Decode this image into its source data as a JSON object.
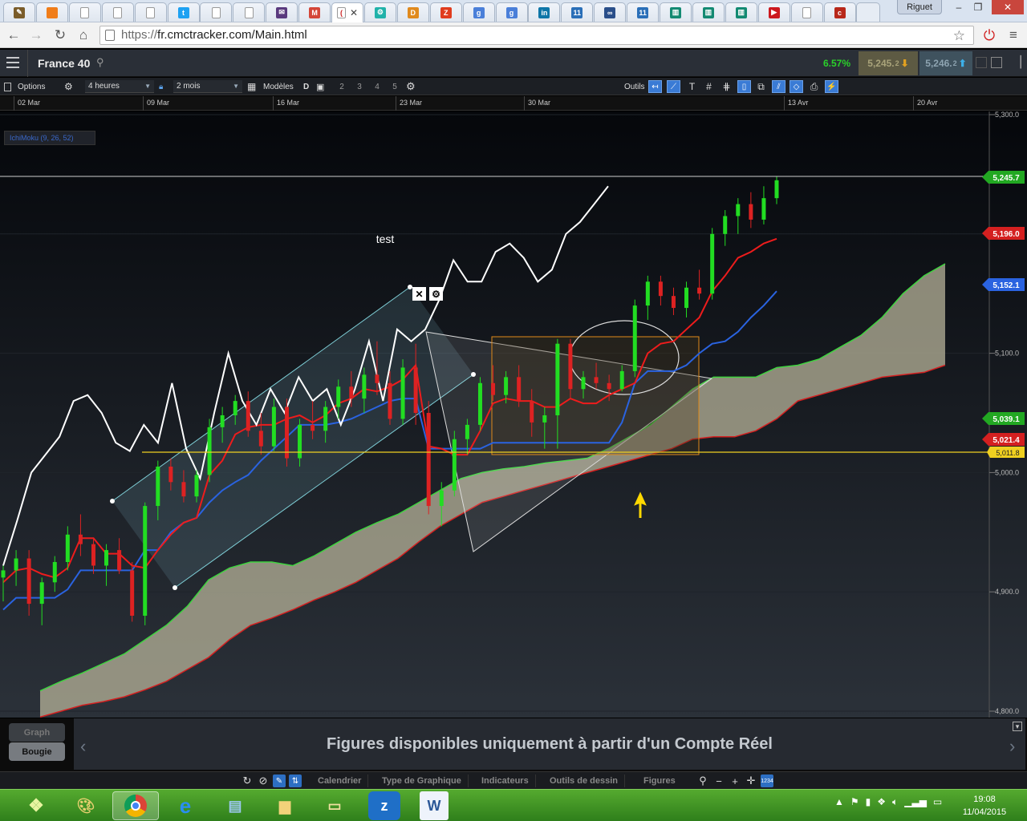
{
  "browser": {
    "tabs": [
      {
        "icon": "pen-icon",
        "color": "#7a5c2a",
        "glyph": "✎"
      },
      {
        "icon": "orange-square-icon",
        "color": "#f07d1a",
        "glyph": ""
      },
      {
        "icon": "page-icon",
        "color": "#ffffff",
        "glyph": ""
      },
      {
        "icon": "page-icon",
        "color": "#ffffff",
        "glyph": ""
      },
      {
        "icon": "page-icon",
        "color": "#ffffff",
        "glyph": ""
      },
      {
        "icon": "twitter-icon",
        "color": "#1da1f2",
        "glyph": "t"
      },
      {
        "icon": "page-icon",
        "color": "#ffffff",
        "glyph": ""
      },
      {
        "icon": "page-icon",
        "color": "#ffffff",
        "glyph": ""
      },
      {
        "icon": "mail-icon",
        "color": "#5a3a7e",
        "glyph": "✉"
      },
      {
        "icon": "gmail-icon",
        "color": "#d44638",
        "glyph": "M"
      },
      {
        "icon": "cmc-icon",
        "color": "#ffffff",
        "glyph": "(",
        "active": true
      },
      {
        "icon": "settings-wheel-icon",
        "color": "#20b2aa",
        "glyph": "⚙"
      },
      {
        "icon": "dfx-icon",
        "color": "#e08a1e",
        "glyph": "D"
      },
      {
        "icon": "zonebourse-icon",
        "color": "#e03c1e",
        "glyph": "Z"
      },
      {
        "icon": "google-icon",
        "color": "#4a7fd9",
        "glyph": "g"
      },
      {
        "icon": "google-icon",
        "color": "#4a7fd9",
        "glyph": "g"
      },
      {
        "icon": "linkedin-icon",
        "color": "#0e76a8",
        "glyph": "in"
      },
      {
        "icon": "calendar-icon",
        "color": "#2a6fb8",
        "glyph": "11"
      },
      {
        "icon": "link-icon",
        "color": "#2a4f8a",
        "glyph": "∞"
      },
      {
        "icon": "calendar-icon",
        "color": "#2a6fb8",
        "glyph": "11"
      },
      {
        "icon": "bars-icon",
        "color": "#138a72",
        "glyph": "▥"
      },
      {
        "icon": "bars-icon",
        "color": "#138a72",
        "glyph": "▥"
      },
      {
        "icon": "bars-icon",
        "color": "#138a72",
        "glyph": "▥"
      },
      {
        "icon": "youtube-icon",
        "color": "#cc181e",
        "glyph": "▶"
      },
      {
        "icon": "page-icon",
        "color": "#ffffff",
        "glyph": ""
      },
      {
        "icon": "red-circle-icon",
        "color": "#b8281a",
        "glyph": "c"
      },
      {
        "icon": "new-tab-icon",
        "color": "#e6ecf4",
        "glyph": ""
      }
    ],
    "profile_name": "Riguet",
    "url_scheme": "https://",
    "url_rest": "fr.cmctracker.com/Main.html"
  },
  "app": {
    "instrument": "France 40",
    "change_pct": "6.57%",
    "sell_price_main": "5,245.",
    "sell_price_small": "2",
    "buy_price_main": "5,246.",
    "buy_price_small": "2"
  },
  "toolbar": {
    "options_label": "Options",
    "timeframe": "4 heures",
    "range": "2 mois",
    "templates_label": "Modèles",
    "d_label": "D",
    "pages": [
      "2",
      "3",
      "4",
      "5"
    ],
    "tools_label": "Outils"
  },
  "dates": [
    "02 Mar",
    "09 Mar",
    "16 Mar",
    "23 Mar",
    "30 Mar",
    "13 Avr",
    "20 Avr"
  ],
  "indicator_legend": "IchiMoku (9, 26, 52)",
  "annotation_text": "test",
  "price_labels": {
    "last": "5,245.7",
    "red": "5,196.0",
    "blue": "5,152.1",
    "green": "5,039.1",
    "red2": "5,021.4",
    "yellow": "5,011.8"
  },
  "bottom": {
    "graph_label": "Graph",
    "bougie_label": "Bougie",
    "banner": "Figures disponibles uniquement à partir d'un Compte Réel",
    "menus": [
      "Calendrier",
      "Type de Graphique",
      "Indicateurs",
      "Outils de dessin",
      "Figures"
    ]
  },
  "taskbar": {
    "time": "19:08",
    "date": "11/04/2015"
  },
  "chart_data": {
    "type": "candlestick",
    "title": "",
    "xlabel": "",
    "ylabel": "",
    "y_ticks": [
      "5,300.0",
      "5,200.0",
      "5,100.0",
      "5,000.0",
      "4,900.0",
      "4,800.0"
    ],
    "ylim": [
      4800,
      5300
    ],
    "x_categories": [
      "02 Mar",
      "09 Mar",
      "16 Mar",
      "23 Mar",
      "30 Mar",
      "13 Avr",
      "20 Avr"
    ],
    "grid": true,
    "horizontal_lines": [
      5245.7,
      5011.8
    ],
    "colors": {
      "up": "#22dd22",
      "down": "#dd2222",
      "tenkan": "#ee1c1c",
      "kijun": "#2a63e0",
      "chikou": "#ffffff",
      "cloud": "#b7b39a",
      "yellow_line": "#f0d020"
    },
    "ohlc": [
      {
        "o": 4912,
        "h": 4922,
        "l": 4892,
        "c": 4918
      },
      {
        "o": 4918,
        "h": 4935,
        "l": 4905,
        "c": 4928
      },
      {
        "o": 4928,
        "h": 4935,
        "l": 4880,
        "c": 4890
      },
      {
        "o": 4890,
        "h": 4912,
        "l": 4872,
        "c": 4908
      },
      {
        "o": 4908,
        "h": 4930,
        "l": 4900,
        "c": 4925
      },
      {
        "o": 4925,
        "h": 4955,
        "l": 4918,
        "c": 4948
      },
      {
        "o": 4948,
        "h": 4965,
        "l": 4930,
        "c": 4940
      },
      {
        "o": 4940,
        "h": 4945,
        "l": 4915,
        "c": 4922
      },
      {
        "o": 4922,
        "h": 4940,
        "l": 4905,
        "c": 4935
      },
      {
        "o": 4935,
        "h": 4945,
        "l": 4915,
        "c": 4918
      },
      {
        "o": 4918,
        "h": 4925,
        "l": 4875,
        "c": 4880
      },
      {
        "o": 4880,
        "h": 4975,
        "l": 4872,
        "c": 4972
      },
      {
        "o": 4972,
        "h": 5010,
        "l": 4960,
        "c": 5005
      },
      {
        "o": 5005,
        "h": 5012,
        "l": 4985,
        "c": 4992
      },
      {
        "o": 4992,
        "h": 5002,
        "l": 4975,
        "c": 4980
      },
      {
        "o": 4980,
        "h": 5002,
        "l": 4975,
        "c": 4998
      },
      {
        "o": 4998,
        "h": 5045,
        "l": 4992,
        "c": 5038
      },
      {
        "o": 5038,
        "h": 5055,
        "l": 5025,
        "c": 5048
      },
      {
        "o": 5048,
        "h": 5065,
        "l": 5040,
        "c": 5060
      },
      {
        "o": 5060,
        "h": 5068,
        "l": 5030,
        "c": 5035
      },
      {
        "o": 5035,
        "h": 5050,
        "l": 5015,
        "c": 5022
      },
      {
        "o": 5022,
        "h": 5062,
        "l": 5018,
        "c": 5055
      },
      {
        "o": 5055,
        "h": 5062,
        "l": 5005,
        "c": 5012
      },
      {
        "o": 5012,
        "h": 5045,
        "l": 5005,
        "c": 5040
      },
      {
        "o": 5040,
        "h": 5060,
        "l": 5028,
        "c": 5035
      },
      {
        "o": 5035,
        "h": 5060,
        "l": 5025,
        "c": 5055
      },
      {
        "o": 5055,
        "h": 5078,
        "l": 5045,
        "c": 5072
      },
      {
        "o": 5072,
        "h": 5085,
        "l": 5055,
        "c": 5062
      },
      {
        "o": 5062,
        "h": 5088,
        "l": 5050,
        "c": 5082
      },
      {
        "o": 5082,
        "h": 5110,
        "l": 5065,
        "c": 5075
      },
      {
        "o": 5075,
        "h": 5085,
        "l": 5040,
        "c": 5045
      },
      {
        "o": 5045,
        "h": 5095,
        "l": 5040,
        "c": 5088
      },
      {
        "o": 5088,
        "h": 5108,
        "l": 5040,
        "c": 5050
      },
      {
        "o": 5050,
        "h": 5060,
        "l": 4965,
        "c": 4972
      },
      {
        "o": 4972,
        "h": 4992,
        "l": 4955,
        "c": 4985
      },
      {
        "o": 4985,
        "h": 5035,
        "l": 4980,
        "c": 5028
      },
      {
        "o": 5028,
        "h": 5045,
        "l": 5015,
        "c": 5040
      },
      {
        "o": 5040,
        "h": 5080,
        "l": 5035,
        "c": 5075
      },
      {
        "o": 5075,
        "h": 5090,
        "l": 5060,
        "c": 5065
      },
      {
        "o": 5065,
        "h": 5085,
        "l": 5058,
        "c": 5080
      },
      {
        "o": 5080,
        "h": 5090,
        "l": 5055,
        "c": 5060
      },
      {
        "o": 5060,
        "h": 5070,
        "l": 5030,
        "c": 5042
      },
      {
        "o": 5042,
        "h": 5055,
        "l": 5020,
        "c": 5048
      },
      {
        "o": 5048,
        "h": 5112,
        "l": 5020,
        "c": 5108
      },
      {
        "o": 5108,
        "h": 5112,
        "l": 5062,
        "c": 5070
      },
      {
        "o": 5070,
        "h": 5085,
        "l": 5062,
        "c": 5080
      },
      {
        "o": 5080,
        "h": 5092,
        "l": 5070,
        "c": 5075
      },
      {
        "o": 5075,
        "h": 5082,
        "l": 5060,
        "c": 5070
      },
      {
        "o": 5070,
        "h": 5090,
        "l": 5068,
        "c": 5085
      },
      {
        "o": 5085,
        "h": 5145,
        "l": 5080,
        "c": 5140
      },
      {
        "o": 5140,
        "h": 5165,
        "l": 5128,
        "c": 5160
      },
      {
        "o": 5160,
        "h": 5165,
        "l": 5140,
        "c": 5148
      },
      {
        "o": 5148,
        "h": 5155,
        "l": 5132,
        "c": 5138
      },
      {
        "o": 5138,
        "h": 5160,
        "l": 5130,
        "c": 5155
      },
      {
        "o": 5155,
        "h": 5170,
        "l": 5145,
        "c": 5150
      },
      {
        "o": 5150,
        "h": 5205,
        "l": 5145,
        "c": 5200
      },
      {
        "o": 5200,
        "h": 5220,
        "l": 5190,
        "c": 5215
      },
      {
        "o": 5215,
        "h": 5230,
        "l": 5200,
        "c": 5225
      },
      {
        "o": 5225,
        "h": 5235,
        "l": 5205,
        "c": 5212
      },
      {
        "o": 5212,
        "h": 5240,
        "l": 5208,
        "c": 5230
      },
      {
        "o": 5230,
        "h": 5248,
        "l": 5225,
        "c": 5245
      }
    ],
    "tenkan": [
      4908,
      4918,
      4920,
      4915,
      4912,
      4920,
      4945,
      4945,
      4932,
      4932,
      4922,
      4920,
      4935,
      4948,
      4958,
      4962,
      4998,
      5010,
      5032,
      5038,
      5040,
      5040,
      5045,
      5048,
      5042,
      5048,
      5058,
      5062,
      5070,
      5068,
      5072,
      5078,
      5090,
      5022,
      5020,
      5015,
      5015,
      5035,
      5058,
      5062,
      5060,
      5060,
      5055,
      5055,
      5062,
      5058,
      5058,
      5065,
      5070,
      5075,
      5100,
      5108,
      5110,
      5120,
      5130,
      5152,
      5165,
      5180,
      5185,
      5192,
      5196
    ],
    "kijun": [
      4885,
      4895,
      4895,
      4895,
      4895,
      4902,
      4918,
      4918,
      4918,
      4918,
      4918,
      4935,
      4935,
      4950,
      4958,
      4962,
      4975,
      4985,
      4992,
      4998,
      5010,
      5020,
      5030,
      5040,
      5040,
      5040,
      5042,
      5045,
      5050,
      5055,
      5060,
      5062,
      5062,
      5020,
      5020,
      5020,
      5020,
      5020,
      5025,
      5025,
      5025,
      5025,
      5025,
      5025,
      5025,
      5025,
      5025,
      5025,
      5042,
      5075,
      5085,
      5085,
      5085,
      5090,
      5100,
      5108,
      5110,
      5118,
      5130,
      5140,
      5152
    ],
    "senkou_a": [
      4817,
      4825,
      4832,
      4840,
      4848,
      4860,
      4872,
      4888,
      4910,
      4920,
      4925,
      4925,
      4922,
      4930,
      4940,
      4950,
      4958,
      4965,
      4975,
      4985,
      4995,
      5000,
      5003,
      5005,
      5008,
      5010,
      5012,
      5020,
      5030,
      5040,
      5055,
      5070,
      5080,
      5080,
      5080,
      5088,
      5090,
      5095,
      5105,
      5115,
      5130,
      5150,
      5165,
      5175
    ],
    "senkou_b": [
      4795,
      4800,
      4805,
      4808,
      4812,
      4818,
      4825,
      4835,
      4845,
      4860,
      4872,
      4878,
      4885,
      4893,
      4900,
      4908,
      4918,
      4928,
      4942,
      4955,
      4965,
      4975,
      4980,
      4985,
      4990,
      4995,
      5000,
      5005,
      5010,
      5015,
      5020,
      5028,
      5030,
      5030,
      5035,
      5045,
      5060,
      5065,
      5070,
      5075,
      5080,
      5082,
      5084,
      5090
    ],
    "chikou": [
      4922,
      4960,
      5000,
      5015,
      5030,
      5060,
      5065,
      5050,
      5025,
      5018,
      5040,
      5025,
      5075,
      5020,
      4995,
      5050,
      5100,
      5060,
      5040,
      5070,
      5050,
      5080,
      5060,
      5070,
      5040,
      5070,
      5110,
      5060,
      5120,
      5110,
      5120,
      5145,
      5178,
      5160,
      5160,
      5185,
      5192,
      5180,
      5160,
      5170,
      5200,
      5210,
      5225,
      5240
    ]
  }
}
